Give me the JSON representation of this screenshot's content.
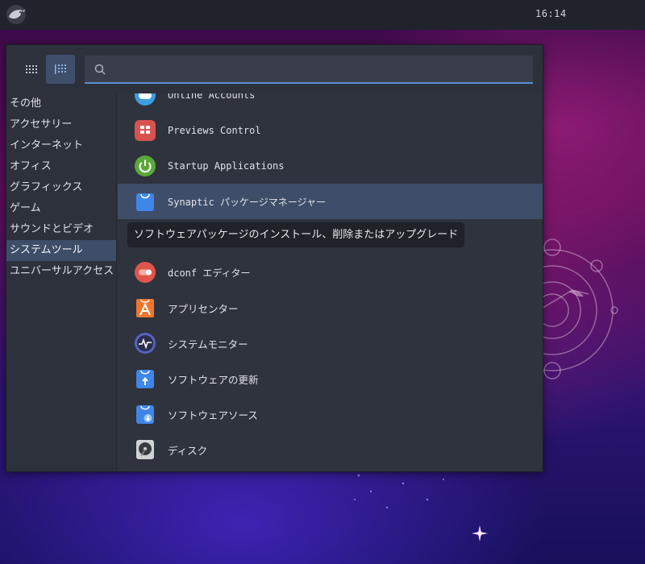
{
  "topbar": {
    "clock": "16:14",
    "logo_icon": "budgie-bird-icon"
  },
  "menu": {
    "view_buttons": [
      {
        "name": "grid-view",
        "active": false
      },
      {
        "name": "list-view",
        "active": true
      }
    ],
    "search": {
      "value": "",
      "placeholder": ""
    },
    "categories": [
      {
        "label": "その他",
        "active": false
      },
      {
        "label": "アクセサリー",
        "active": false
      },
      {
        "label": "インターネット",
        "active": false
      },
      {
        "label": "オフィス",
        "active": false
      },
      {
        "label": "グラフィックス",
        "active": false
      },
      {
        "label": "ゲーム",
        "active": false
      },
      {
        "label": "サウンドとビデオ",
        "active": false
      },
      {
        "label": "システムツール",
        "active": true
      },
      {
        "label": "ユニバーサルアクセス",
        "active": false
      }
    ],
    "apps": [
      {
        "label": "Online Accounts",
        "icon": "online-accounts-icon"
      },
      {
        "label": "Previews Control",
        "icon": "previews-control-icon"
      },
      {
        "label": "Startup Applications",
        "icon": "power-icon"
      },
      {
        "label": "Synaptic パッケージマネージャー",
        "icon": "package-bag-icon",
        "selected": true
      },
      {
        "label": "dconf エディター",
        "icon": "dconf-toggle-icon"
      },
      {
        "label": "アプリセンター",
        "icon": "app-center-icon"
      },
      {
        "label": "システムモニター",
        "icon": "system-monitor-icon"
      },
      {
        "label": "ソフトウェアの更新",
        "icon": "software-update-icon"
      },
      {
        "label": "ソフトウェアソース",
        "icon": "software-sources-icon"
      },
      {
        "label": "ディスク",
        "icon": "disk-icon"
      }
    ],
    "tooltip": "ソフトウェアパッケージのインストール、削除またはアップグレード"
  },
  "colors": {
    "panel_bg": "#2d313c",
    "selection": "#3e4e68",
    "accent": "#5b8fd6"
  }
}
